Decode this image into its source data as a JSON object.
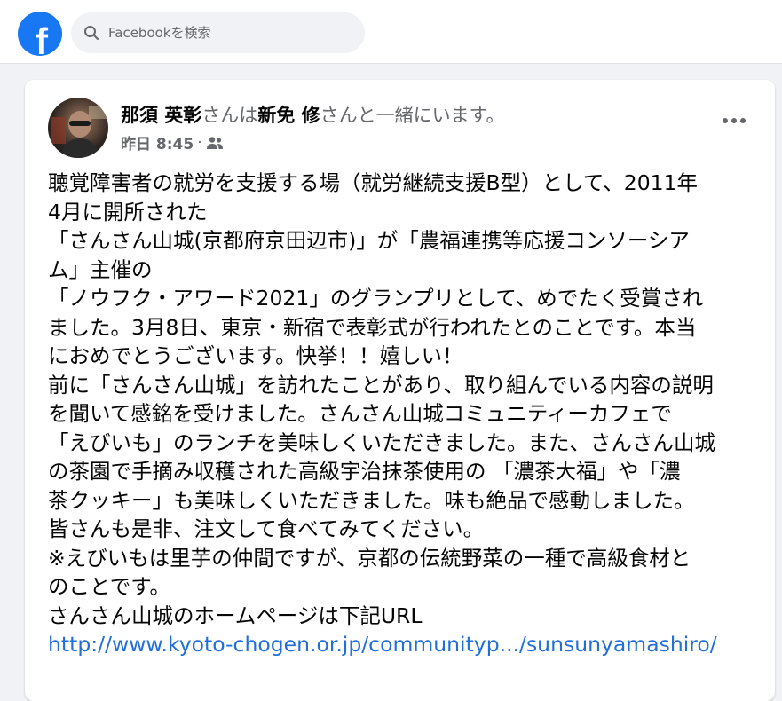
{
  "topbar": {
    "logo_letter": "f",
    "search_placeholder": "Facebookを検索"
  },
  "colors": {
    "brand": "#1877f2",
    "link": "#216fdb",
    "secondary_text": "#65676b"
  },
  "post": {
    "author": "那須 英彰",
    "with_prefix": "さんは",
    "tagged": "新免 修",
    "with_suffix": "さんと一緒にいます。",
    "time": "昨日 8:45",
    "separator": "·",
    "audience_icon": "friends-icon",
    "more_icon": "more-options-icon",
    "lines": [
      "聴覚障害者の就労を支援する場（就労継続支援B型）として、2011年",
      "4月に開所された",
      "「さんさん山城(京都府京田辺市)」が「農福連携等応援コンソーシア",
      "ム」主催の",
      "「ノウフク・アワード2021」のグランプリとして、めでたく受賞され",
      "ました。3月8日、東京・新宿で表彰式が行われたとのことです。本当",
      "におめでとうございます。快挙！！嬉しい！",
      "前に「さんさん山城」を訪れたことがあり、取り組んでいる内容の説明",
      "を聞いて感銘を受けました。さんさん山城コミュニティーカフェで",
      "「えびいも」のランチを美味しくいただきました。また、さんさん山城",
      "の茶園で手摘み収穫された高級宇治抹茶使用の 「濃茶大福」や「濃",
      "茶クッキー」も美味しくいただきました。味も絶品で感動しました。",
      "皆さんも是非、注文して食べてみてください。",
      "※えびいもは里芋の仲間ですが、京都の伝統野菜の一種で高級食材と",
      "のことです。",
      "さんさん山城のホームページは下記URL"
    ],
    "link_text": "http://www.kyoto-chogen.or.jp/communityp.../sunsunyamashiro/"
  }
}
